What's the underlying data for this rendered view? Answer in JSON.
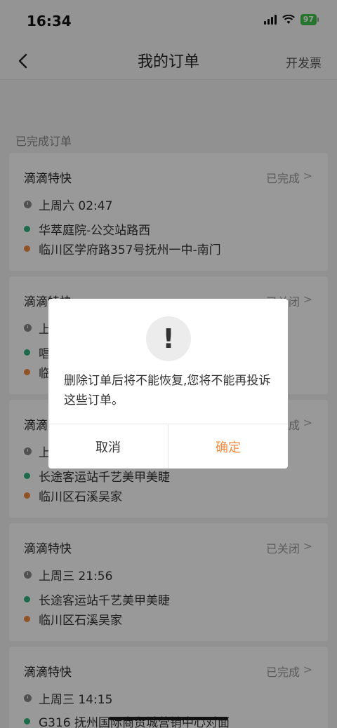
{
  "status_bar": {
    "time": "16:34",
    "battery": "97"
  },
  "nav": {
    "title": "我的订单",
    "action": "开发票"
  },
  "section_header": "已完成订单",
  "orders": [
    {
      "title": "滴滴特快",
      "status": "已完成",
      "time": "上周六 02:47",
      "from": "华萃庭院-公交站路西",
      "to": "临川区学府路357号抚州一中-南门"
    },
    {
      "title": "滴滴特快",
      "status": "已关闭",
      "time": "上",
      "from": "唱",
      "to": "临"
    },
    {
      "title": "滴滴",
      "status": "成",
      "time": "上",
      "from": "长途客运站千艺美甲美睫",
      "to": "临川区石溪吴家"
    },
    {
      "title": "滴滴特快",
      "status": "已关闭",
      "time": "上周三 21:56",
      "from": "长途客运站千艺美甲美睫",
      "to": "临川区石溪吴家"
    },
    {
      "title": "滴滴特快",
      "status": "已完成",
      "time": "上周三 14:15",
      "from": "G316 抚州国际商贸城营销中心对面",
      "to": ""
    }
  ],
  "dialog": {
    "icon": "alert-icon",
    "message": "删除订单后将不能恢复,您将不能再投诉这些订单。",
    "cancel": "取消",
    "confirm": "确定"
  },
  "colors": {
    "accent": "#f28a3e",
    "start_dot": "#2fb37c",
    "end_dot": "#f28a3e",
    "battery": "#3ec44a"
  }
}
